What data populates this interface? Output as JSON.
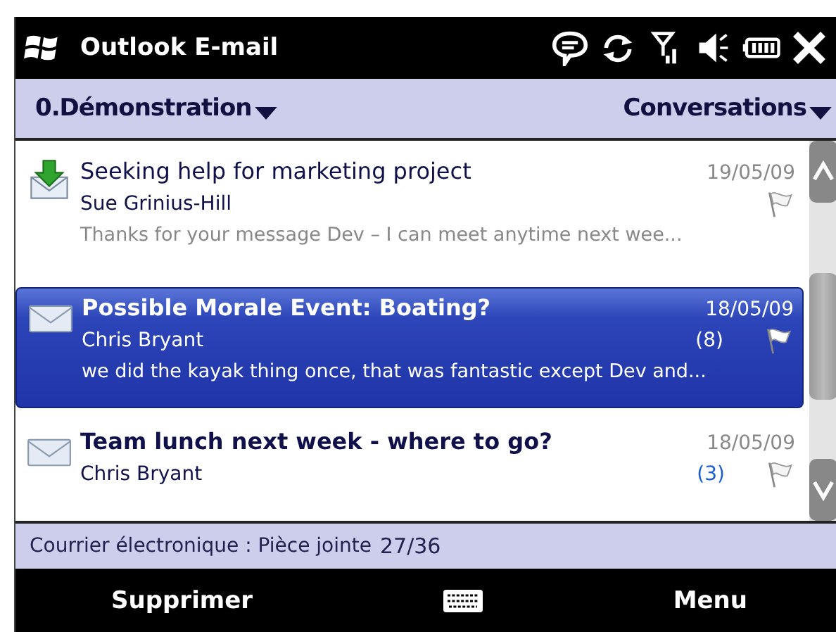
{
  "window": {
    "title": "Outlook E-mail"
  },
  "header": {
    "account": "0.Démonstration",
    "view": "Conversations"
  },
  "messages": [
    {
      "kind": "download",
      "subject": "Seeking help for marketing project",
      "sender": "Sue Grinius-Hill",
      "date": "19/05/09",
      "preview": "Thanks for your message Dev –    I can meet anytime next wee...",
      "unread": false,
      "selected": false
    },
    {
      "kind": "envelope",
      "subject": "Possible Morale Event: Boating?",
      "sender": "Chris Bryant",
      "date": "18/05/09",
      "count": "(8)",
      "preview": "we did the kayak thing once, that was fantastic except Dev and...",
      "unread": true,
      "selected": true
    },
    {
      "kind": "envelope",
      "subject": "Team lunch next week - where to go?",
      "sender": "Chris Bryant",
      "date": "18/05/09",
      "count": "(3)",
      "unread": true,
      "selected": false
    }
  ],
  "status_bar": {
    "label": "Courrier électronique : Pièce jointe",
    "counter": "27/36"
  },
  "softkeys": {
    "left": "Supprimer",
    "right": "Menu"
  }
}
